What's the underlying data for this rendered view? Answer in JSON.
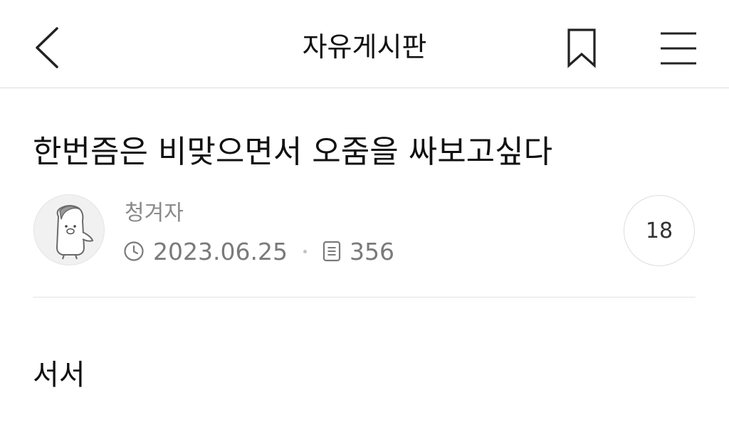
{
  "header": {
    "title": "자유게시판",
    "back_icon": "chevron-left-icon",
    "bookmark_icon": "bookmark-icon",
    "menu_icon": "hamburger-menu-icon"
  },
  "post": {
    "title": "한번즘은 비맞으면서 오줌을 싸보고싶다",
    "author": "청겨자",
    "date": "2023.06.25",
    "views": "356",
    "comment_count": "18",
    "body": "서서"
  },
  "colors": {
    "text_primary": "#111111",
    "text_secondary": "#7a7a7a",
    "divider": "#e2e2e2"
  }
}
